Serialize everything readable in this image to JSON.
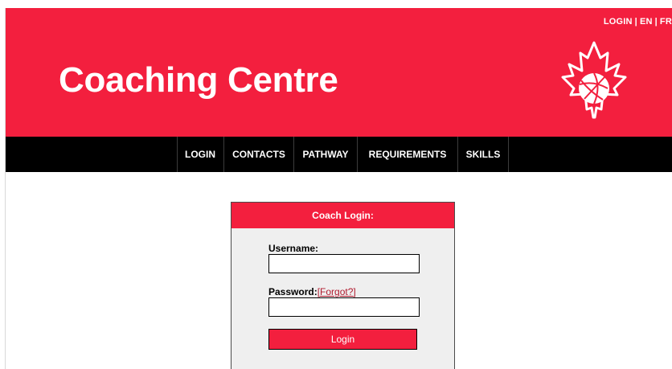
{
  "header": {
    "top_links": {
      "login": "LOGIN",
      "en": "EN",
      "fr": "FR",
      "separator": "|"
    },
    "title": "Coaching Centre",
    "logo_icon": "maple-leaf-volleyball-icon"
  },
  "nav": {
    "items": [
      {
        "label": "LOGIN"
      },
      {
        "label": "CONTACTS"
      },
      {
        "label": "PATHWAY"
      },
      {
        "label": "REQUIREMENTS"
      },
      {
        "label": "SKILLS"
      }
    ]
  },
  "login": {
    "heading": "Coach Login:",
    "username_label": "Username:",
    "username_value": "",
    "password_label": "Password:",
    "forgot_link": "[Forgot?]",
    "password_value": "",
    "submit_label": "Login"
  },
  "colors": {
    "brand_red": "#f31f3e",
    "nav_black": "#000000",
    "panel_gray": "#efefef",
    "link_red": "#b01a2e"
  }
}
